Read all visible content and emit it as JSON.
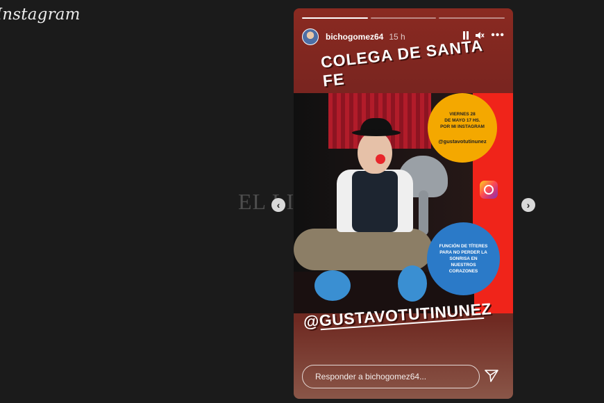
{
  "app": {
    "logo": "Instagram"
  },
  "story": {
    "username": "bichogomez64",
    "time_ago": "15 h",
    "progress": {
      "segments": 3,
      "completed": 1
    },
    "title": "COLEGA DE SANTA FE",
    "event": {
      "line1": "VIERNES 28",
      "line2": "DE MAYO 17 HS.",
      "line3": "POR MI INSTAGRAM",
      "handle": "@gustavotutinunez"
    },
    "description": "FUNCIÓN DE TÍTERES PARA NO PERDER LA SONRISA EN NUESTROS CORAZONES",
    "big_handle": "@GUSTAVOTUTINUNEZ",
    "reply_placeholder": "Responder a bichogomez64...",
    "icons": [
      "pause-icon",
      "volume-muted-icon",
      "more-icon",
      "instagram-icon",
      "send-icon"
    ]
  },
  "nav": {
    "prev": "‹",
    "next": "›"
  },
  "watermark": "EL LITORAL"
}
